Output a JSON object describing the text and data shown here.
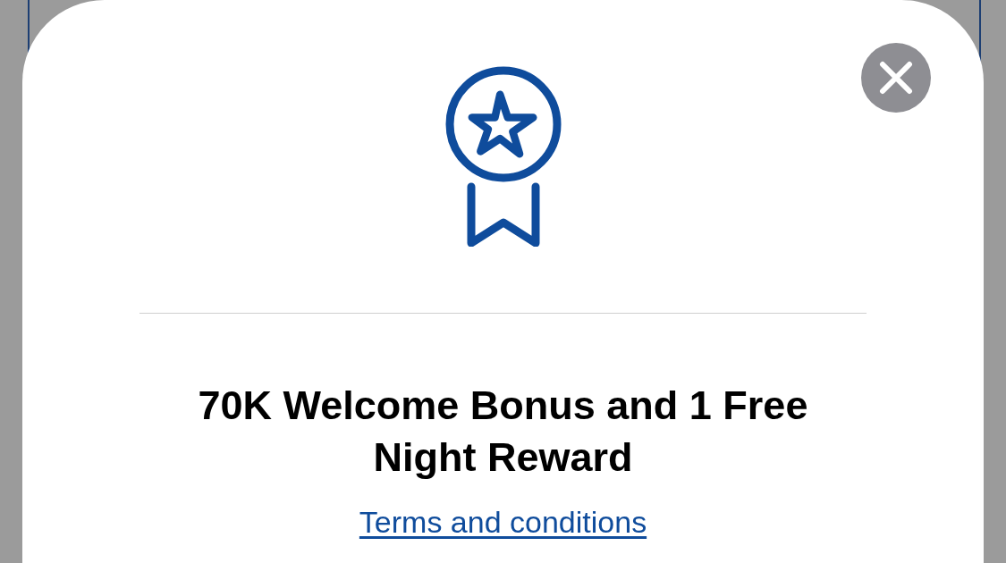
{
  "modal": {
    "title": "70K Welcome Bonus and 1 Free Night Reward",
    "link": "Terms and conditions"
  }
}
